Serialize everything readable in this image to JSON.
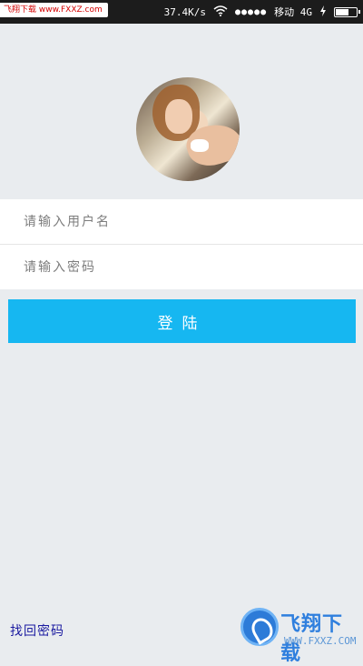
{
  "status_bar": {
    "watermark": "飞翔下载 www.FXXZ.com",
    "net_speed": "37.4K/s",
    "signal": "●●●●●",
    "carrier": "移动 4G",
    "battery_level": 0.7
  },
  "login": {
    "username_placeholder": "请输入用户名",
    "username_value": "",
    "password_placeholder": "请输入密码",
    "password_value": "",
    "submit_label": "登陆",
    "forgot_label": "找回密码"
  },
  "logo": {
    "title": "飞翔下载",
    "url": "WWW.FXXZ.COM"
  },
  "colors": {
    "primary": "#16b7f1",
    "background": "#e9ecef",
    "status_bar": "#1c1c1c",
    "link": "#1a1aa0"
  }
}
